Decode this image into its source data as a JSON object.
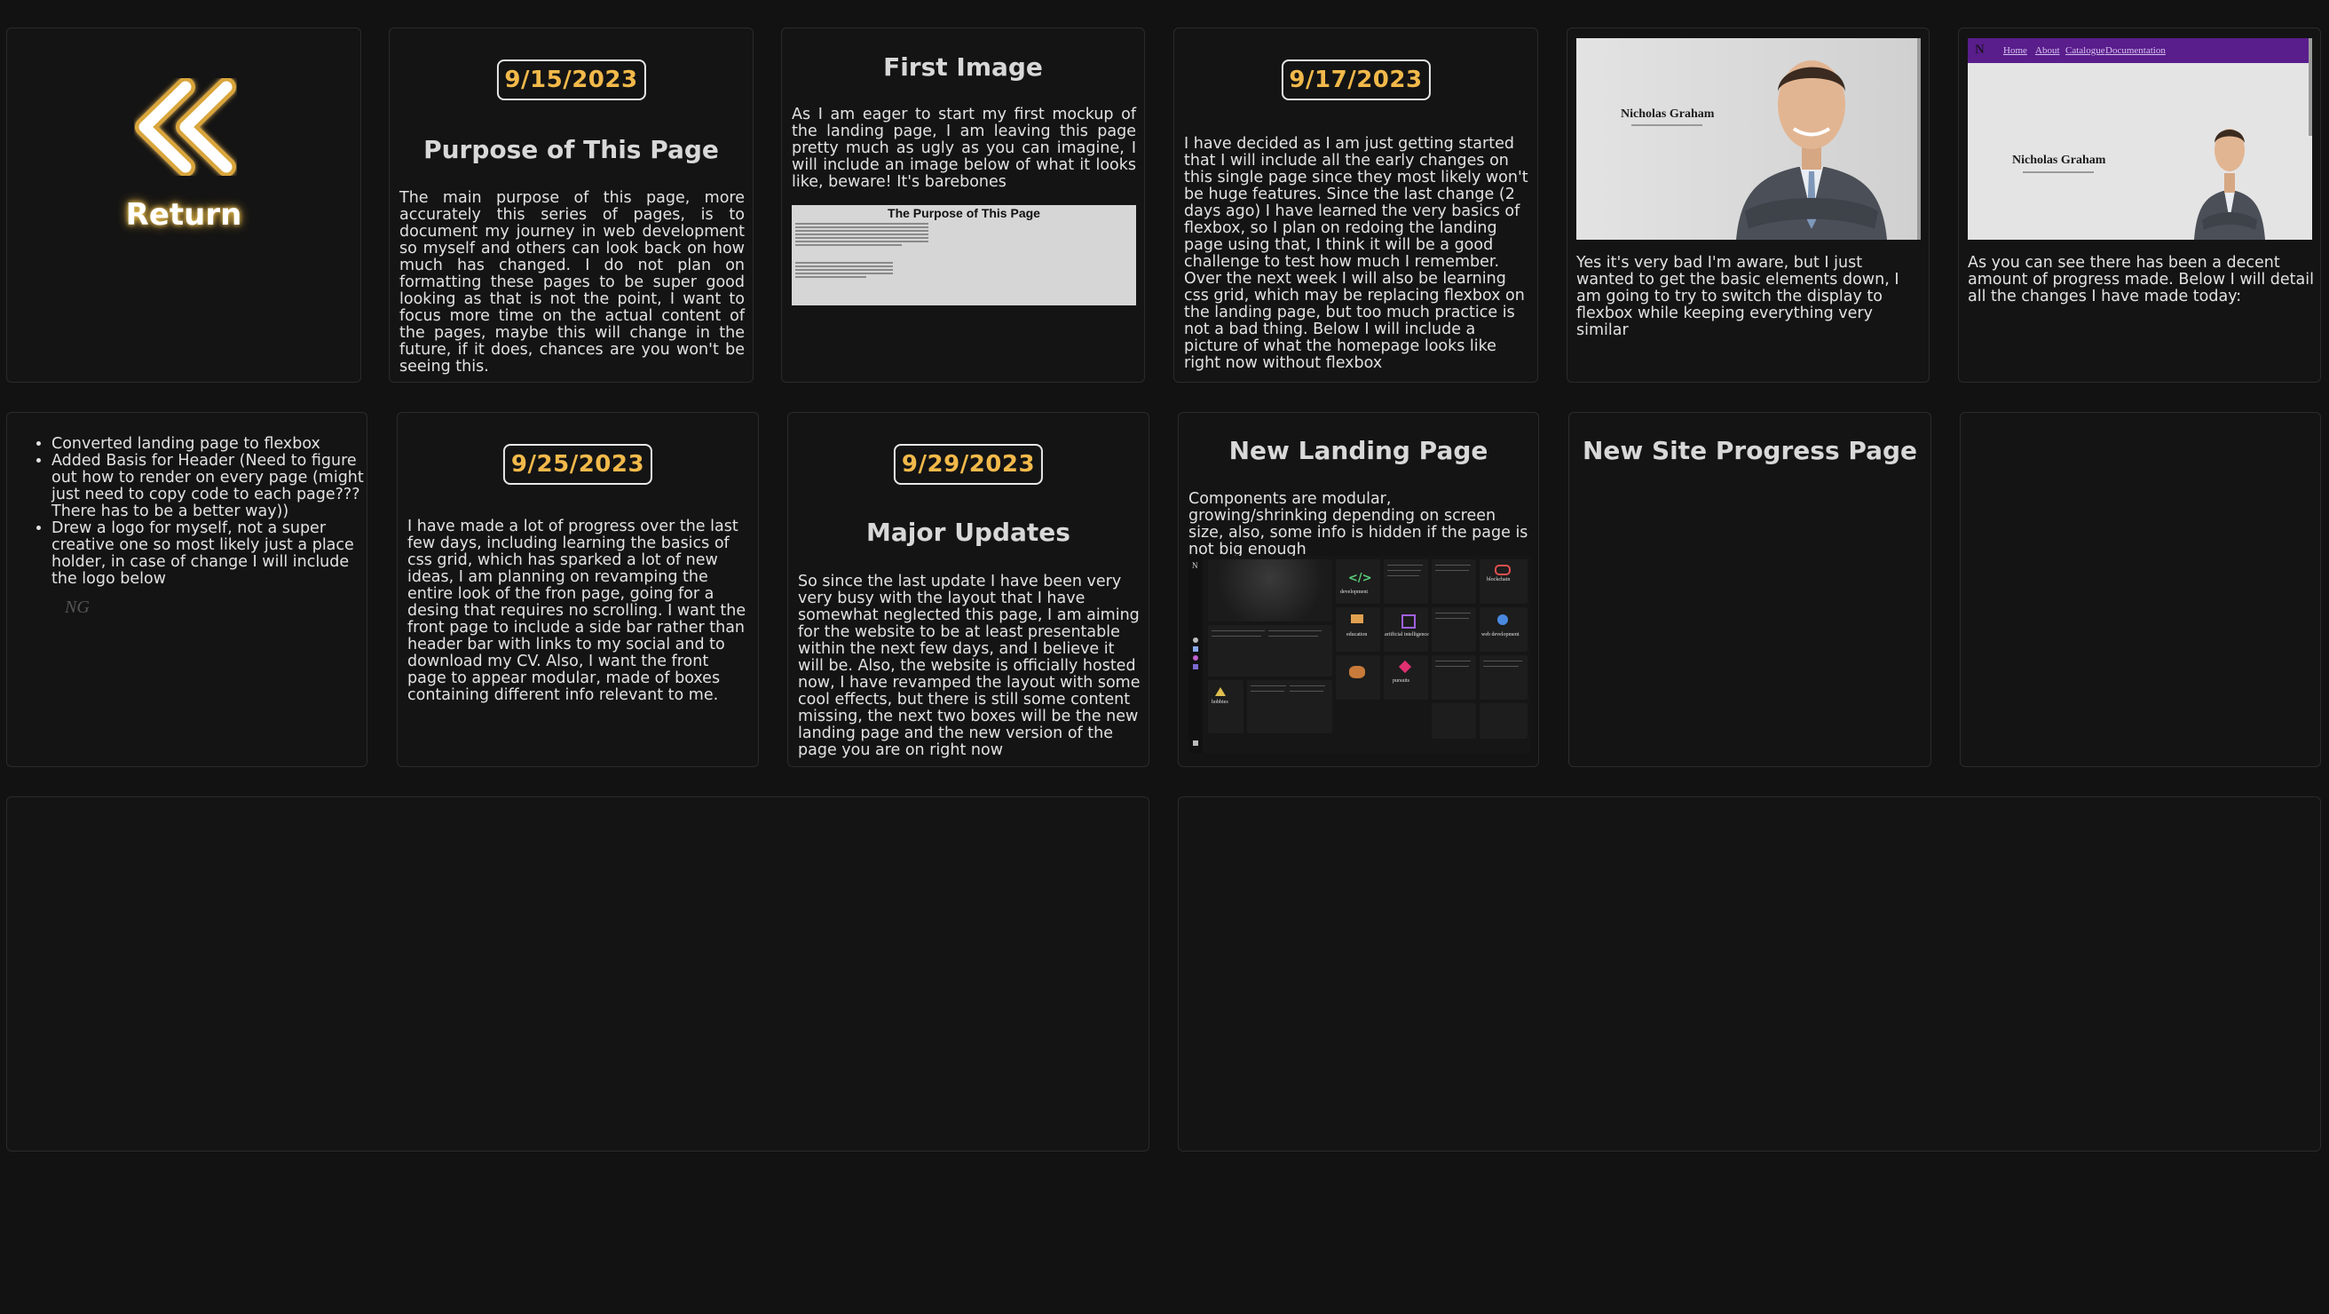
{
  "return_card": {
    "label": "Return",
    "icon": "double-chevron-left-icon"
  },
  "purpose_card": {
    "date": "9/15/2023",
    "title": "Purpose of This Page",
    "text": "The main purpose of this page, more accurately this series of pages, is to document my journey in web development so myself and others can look back on how much has changed. I do not plan on formatting these pages to be super good looking as that is not the point, I want to focus more time on the actual content of the pages, maybe this will change in the future, if it does, chances are you won't be seeing this."
  },
  "first_image_card": {
    "title": "First Image",
    "text": "As I am eager to start my first mockup of the landing page, I am leaving this page pretty much as ugly as you can imagine, I will include an image below of what it looks like, beware! It's barebones",
    "image_title": "The Purpose of This Page"
  },
  "flexbox_card": {
    "date": "9/17/2023",
    "text": "I have decided as I am just getting started that I will include all the early changes on this single page since they most likely won't be huge features. Since the last change (2 days ago) I have learned the very basics of flexbox, so I plan on redoing the landing page using that, I think it will be a good challenge to test how much I remember. Over the next week I will also be learning css grid, which may be replacing flexbox on the landing page, but too much practice is not a bad thing. Below I will include a picture of what the homepage looks like right now without flexbox"
  },
  "homepage_shot_card": {
    "image_name": "Nicholas Graham",
    "text": "Yes it's very bad I'm aware, but I just wanted to get the basic elements down, I am going to try to switch the display to flexbox while keeping everything very similar"
  },
  "progress_shot_card": {
    "image_name": "Nicholas Graham",
    "nav_links": [
      "Home",
      "About",
      "Catalogue",
      "Documentation"
    ],
    "text": "As you can see there has been a decent amount of progress made. Below I will detail all the changes I have made today:"
  },
  "changes_card": {
    "items": [
      "Converted landing page to flexbox",
      "Added Basis for Header (Need to figure out how to render on every page (might just need to copy code to each page??? There has to be a better way))",
      "Drew a logo for myself, not a super creative one so most likely just a place holder, in case of change I will include the logo below"
    ],
    "logo_text": "NG"
  },
  "grid_card": {
    "date": "9/25/2023",
    "text": "I have made a lot of progress over the last few days, including learning the basics of css grid, which has sparked a lot of new ideas, I am planning on revamping the entire look of the fron page, going for a desing that requires no scrolling. I want the front page to include a side bar rather than header bar with links to my social and to download my CV. Also, I want the front page to appear modular, made of boxes containing different info relevant to me."
  },
  "major_card": {
    "date": "9/29/2023",
    "title": "Major Updates",
    "text": "So since the last update I have been very very busy with the layout that I have somewhat neglected this page, I am aiming for the website to be at least presentable within the next few days, and I believe it will be. Also, the website is officially hosted now, I have revamped the layout with some cool effects, but there is still some content missing, the next two boxes will be the new landing page and the new version of the page you are on right now"
  },
  "new_landing_card": {
    "title": "New Landing Page",
    "text": "Components are modular, growing/shrinking depending on screen size, also, some info is hidden if the page is not big enough",
    "tiles": [
      "development",
      "blockchain",
      "education",
      "artificial intelligence",
      "web development",
      "hobbies",
      "pursuits"
    ]
  },
  "new_progress_card": {
    "title": "New Site Progress Page"
  },
  "colors": {
    "background": "#121212",
    "card": "#141414",
    "date_accent": "#f2b94a",
    "glow": "#ffd45a",
    "nav_purple": "#5a1d8c"
  }
}
